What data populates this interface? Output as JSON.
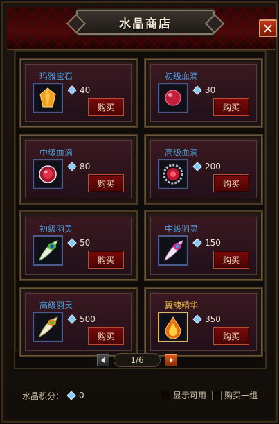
{
  "window": {
    "title": "水晶商店",
    "close_icon": "close-icon"
  },
  "items": [
    {
      "name": "玛雅宝石",
      "price": "40",
      "buy_label": "购买",
      "icon": "amber-gem-icon",
      "name_color": "blue"
    },
    {
      "name": "初级血滴",
      "price": "30",
      "buy_label": "购买",
      "icon": "blood-drop-small-icon",
      "name_color": "blue"
    },
    {
      "name": "中级血滴",
      "price": "80",
      "buy_label": "购买",
      "icon": "blood-drop-medium-icon",
      "name_color": "blue"
    },
    {
      "name": "高级血滴",
      "price": "200",
      "buy_label": "购买",
      "icon": "blood-drop-large-icon",
      "name_color": "blue"
    },
    {
      "name": "初级羽灵",
      "price": "50",
      "buy_label": "购买",
      "icon": "feather-small-icon",
      "name_color": "blue"
    },
    {
      "name": "中级羽灵",
      "price": "150",
      "buy_label": "购买",
      "icon": "feather-medium-icon",
      "name_color": "blue"
    },
    {
      "name": "高级羽灵",
      "price": "500",
      "buy_label": "购买",
      "icon": "feather-large-icon",
      "name_color": "blue"
    },
    {
      "name": "翼魂精华",
      "price": "350",
      "buy_label": "购买",
      "icon": "fire-essence-icon",
      "name_color": "gold"
    }
  ],
  "pager": {
    "current": "1/6",
    "prev_icon": "arrow-left-icon",
    "next_icon": "arrow-right-icon"
  },
  "footer": {
    "points_label": "水晶积分：",
    "points_value": "0",
    "show_available_label": "显示可用",
    "buy_group_label": "购买一组"
  },
  "colors": {
    "item_name_blue": "#4a9cd8",
    "item_name_gold": "#f0c24a",
    "buy_button": "#7a0a0a",
    "header_red": "#4a0a0a"
  }
}
